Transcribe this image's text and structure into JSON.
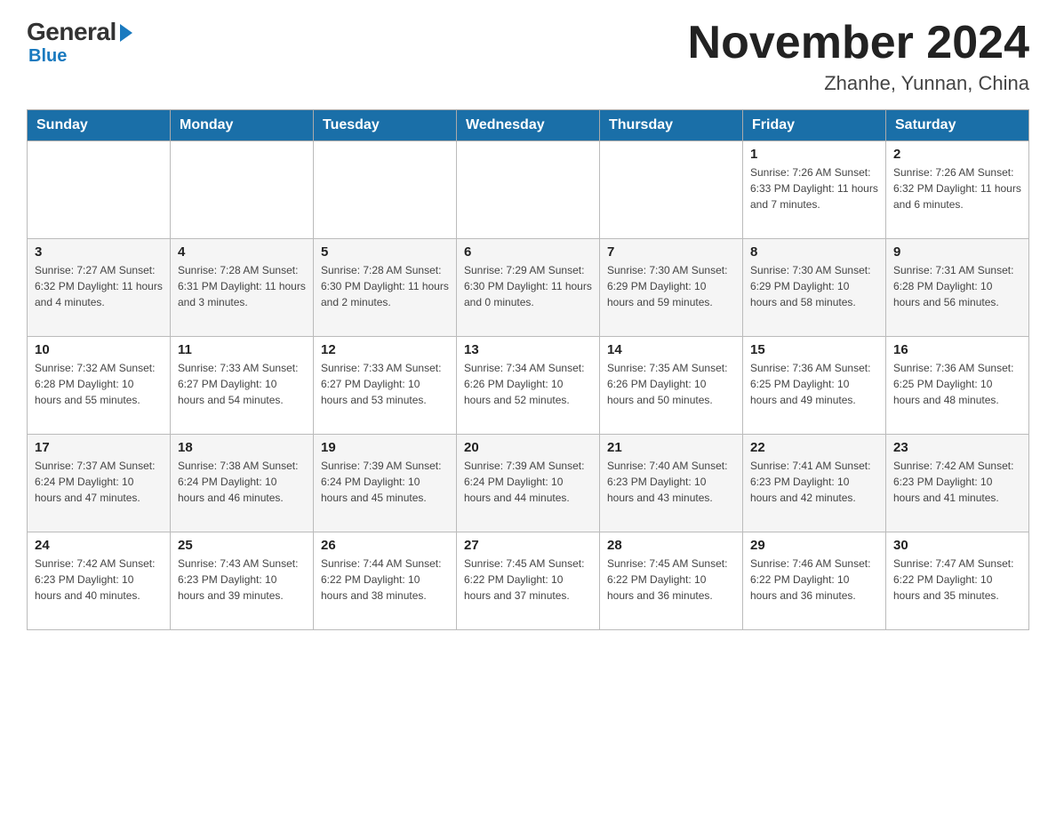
{
  "logo": {
    "general": "General",
    "blue": "Blue"
  },
  "header": {
    "month": "November 2024",
    "location": "Zhanhe, Yunnan, China"
  },
  "weekdays": [
    "Sunday",
    "Monday",
    "Tuesday",
    "Wednesday",
    "Thursday",
    "Friday",
    "Saturday"
  ],
  "weeks": [
    [
      {
        "day": "",
        "info": ""
      },
      {
        "day": "",
        "info": ""
      },
      {
        "day": "",
        "info": ""
      },
      {
        "day": "",
        "info": ""
      },
      {
        "day": "",
        "info": ""
      },
      {
        "day": "1",
        "info": "Sunrise: 7:26 AM\nSunset: 6:33 PM\nDaylight: 11 hours and 7 minutes."
      },
      {
        "day": "2",
        "info": "Sunrise: 7:26 AM\nSunset: 6:32 PM\nDaylight: 11 hours and 6 minutes."
      }
    ],
    [
      {
        "day": "3",
        "info": "Sunrise: 7:27 AM\nSunset: 6:32 PM\nDaylight: 11 hours and 4 minutes."
      },
      {
        "day": "4",
        "info": "Sunrise: 7:28 AM\nSunset: 6:31 PM\nDaylight: 11 hours and 3 minutes."
      },
      {
        "day": "5",
        "info": "Sunrise: 7:28 AM\nSunset: 6:30 PM\nDaylight: 11 hours and 2 minutes."
      },
      {
        "day": "6",
        "info": "Sunrise: 7:29 AM\nSunset: 6:30 PM\nDaylight: 11 hours and 0 minutes."
      },
      {
        "day": "7",
        "info": "Sunrise: 7:30 AM\nSunset: 6:29 PM\nDaylight: 10 hours and 59 minutes."
      },
      {
        "day": "8",
        "info": "Sunrise: 7:30 AM\nSunset: 6:29 PM\nDaylight: 10 hours and 58 minutes."
      },
      {
        "day": "9",
        "info": "Sunrise: 7:31 AM\nSunset: 6:28 PM\nDaylight: 10 hours and 56 minutes."
      }
    ],
    [
      {
        "day": "10",
        "info": "Sunrise: 7:32 AM\nSunset: 6:28 PM\nDaylight: 10 hours and 55 minutes."
      },
      {
        "day": "11",
        "info": "Sunrise: 7:33 AM\nSunset: 6:27 PM\nDaylight: 10 hours and 54 minutes."
      },
      {
        "day": "12",
        "info": "Sunrise: 7:33 AM\nSunset: 6:27 PM\nDaylight: 10 hours and 53 minutes."
      },
      {
        "day": "13",
        "info": "Sunrise: 7:34 AM\nSunset: 6:26 PM\nDaylight: 10 hours and 52 minutes."
      },
      {
        "day": "14",
        "info": "Sunrise: 7:35 AM\nSunset: 6:26 PM\nDaylight: 10 hours and 50 minutes."
      },
      {
        "day": "15",
        "info": "Sunrise: 7:36 AM\nSunset: 6:25 PM\nDaylight: 10 hours and 49 minutes."
      },
      {
        "day": "16",
        "info": "Sunrise: 7:36 AM\nSunset: 6:25 PM\nDaylight: 10 hours and 48 minutes."
      }
    ],
    [
      {
        "day": "17",
        "info": "Sunrise: 7:37 AM\nSunset: 6:24 PM\nDaylight: 10 hours and 47 minutes."
      },
      {
        "day": "18",
        "info": "Sunrise: 7:38 AM\nSunset: 6:24 PM\nDaylight: 10 hours and 46 minutes."
      },
      {
        "day": "19",
        "info": "Sunrise: 7:39 AM\nSunset: 6:24 PM\nDaylight: 10 hours and 45 minutes."
      },
      {
        "day": "20",
        "info": "Sunrise: 7:39 AM\nSunset: 6:24 PM\nDaylight: 10 hours and 44 minutes."
      },
      {
        "day": "21",
        "info": "Sunrise: 7:40 AM\nSunset: 6:23 PM\nDaylight: 10 hours and 43 minutes."
      },
      {
        "day": "22",
        "info": "Sunrise: 7:41 AM\nSunset: 6:23 PM\nDaylight: 10 hours and 42 minutes."
      },
      {
        "day": "23",
        "info": "Sunrise: 7:42 AM\nSunset: 6:23 PM\nDaylight: 10 hours and 41 minutes."
      }
    ],
    [
      {
        "day": "24",
        "info": "Sunrise: 7:42 AM\nSunset: 6:23 PM\nDaylight: 10 hours and 40 minutes."
      },
      {
        "day": "25",
        "info": "Sunrise: 7:43 AM\nSunset: 6:23 PM\nDaylight: 10 hours and 39 minutes."
      },
      {
        "day": "26",
        "info": "Sunrise: 7:44 AM\nSunset: 6:22 PM\nDaylight: 10 hours and 38 minutes."
      },
      {
        "day": "27",
        "info": "Sunrise: 7:45 AM\nSunset: 6:22 PM\nDaylight: 10 hours and 37 minutes."
      },
      {
        "day": "28",
        "info": "Sunrise: 7:45 AM\nSunset: 6:22 PM\nDaylight: 10 hours and 36 minutes."
      },
      {
        "day": "29",
        "info": "Sunrise: 7:46 AM\nSunset: 6:22 PM\nDaylight: 10 hours and 36 minutes."
      },
      {
        "day": "30",
        "info": "Sunrise: 7:47 AM\nSunset: 6:22 PM\nDaylight: 10 hours and 35 minutes."
      }
    ]
  ]
}
